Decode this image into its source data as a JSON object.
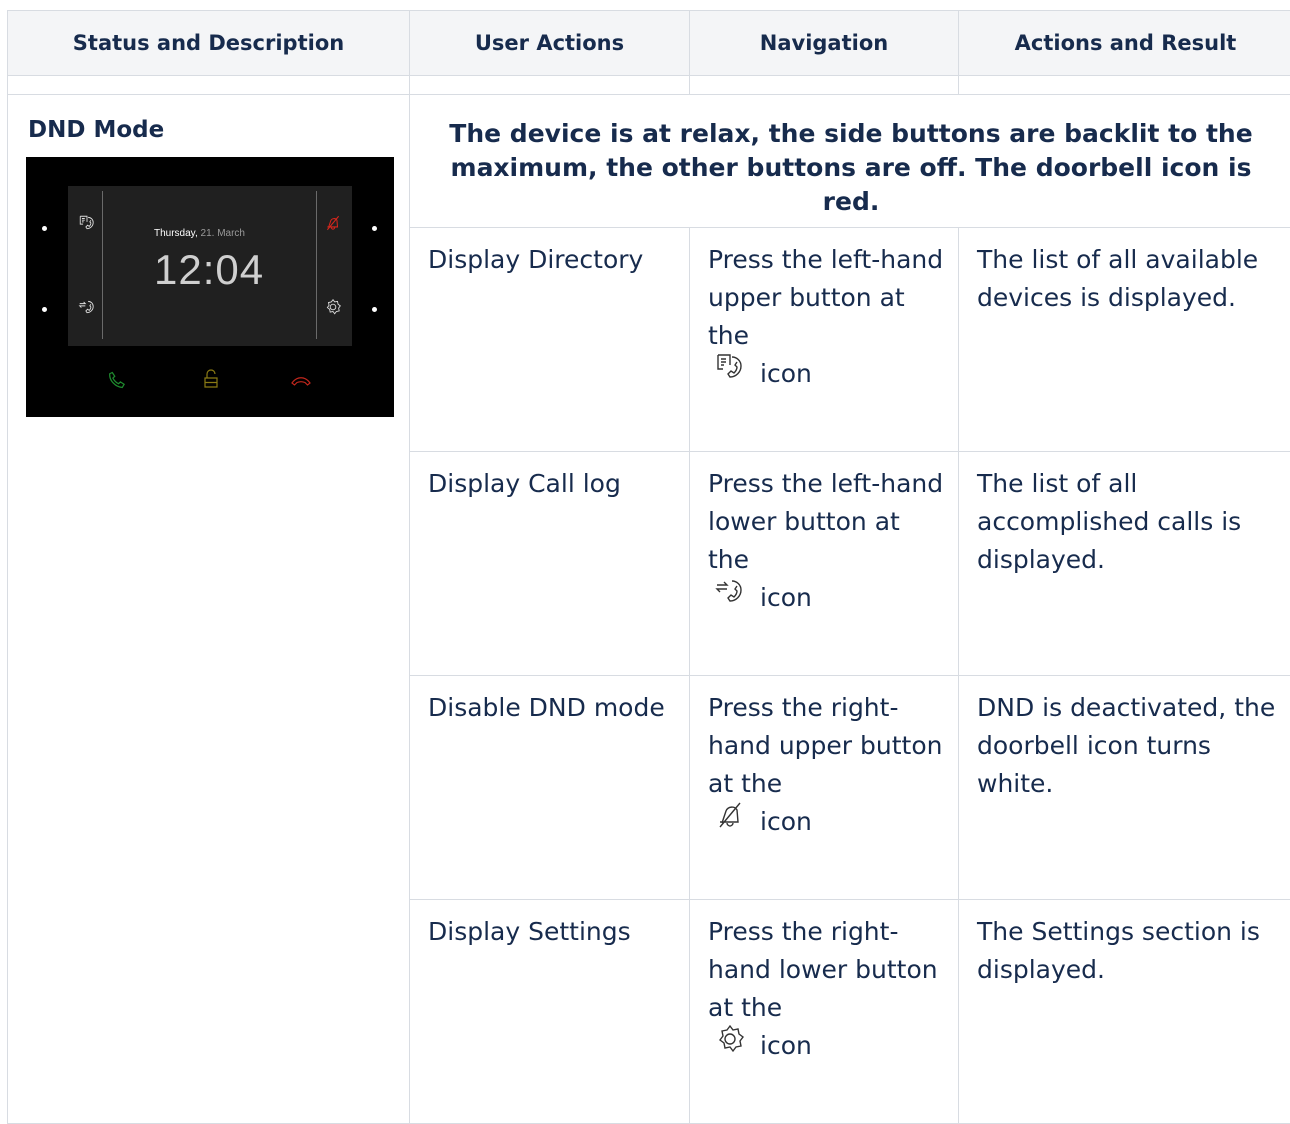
{
  "header": {
    "col1": "Status and Description",
    "col2": "User Actions",
    "col3": "Navigation",
    "col4": "Actions and Result"
  },
  "status": {
    "title": "DND Mode",
    "device": {
      "weekday": "Thursday,",
      "date": "21. March",
      "time": "12:04",
      "colors": {
        "call": "#1e8a2e",
        "lock": "#8a7a14",
        "hangup": "#c0261c",
        "dnd": "#d8261c"
      }
    }
  },
  "description": "The device is at relax, the side buttons are backlit to the maximum, the other buttons are off. The doorbell icon is red.",
  "rows": [
    {
      "action": "Display Directory",
      "nav_text": "Press the left-hand upper button at the",
      "icon": "directory-icon",
      "icon_suffix": "icon",
      "result": "The list of all available devices is displayed."
    },
    {
      "action": "Display Call log",
      "nav_text": "Press the left-hand lower button at the",
      "icon": "call-log-icon",
      "icon_suffix": "icon",
      "result": "The list of all accomplished calls is displayed."
    },
    {
      "action": "Disable DND mode",
      "nav_text": "Press the right-hand upper button at the",
      "icon": "bell-off-icon",
      "icon_suffix": "icon",
      "result": "DND is deactivated, the doorbell icon turns white."
    },
    {
      "action": "Display Settings",
      "nav_text": "Press the right-hand lower button at the",
      "icon": "settings-gear-icon",
      "icon_suffix": "icon",
      "result": "The Settings section is displayed."
    }
  ]
}
